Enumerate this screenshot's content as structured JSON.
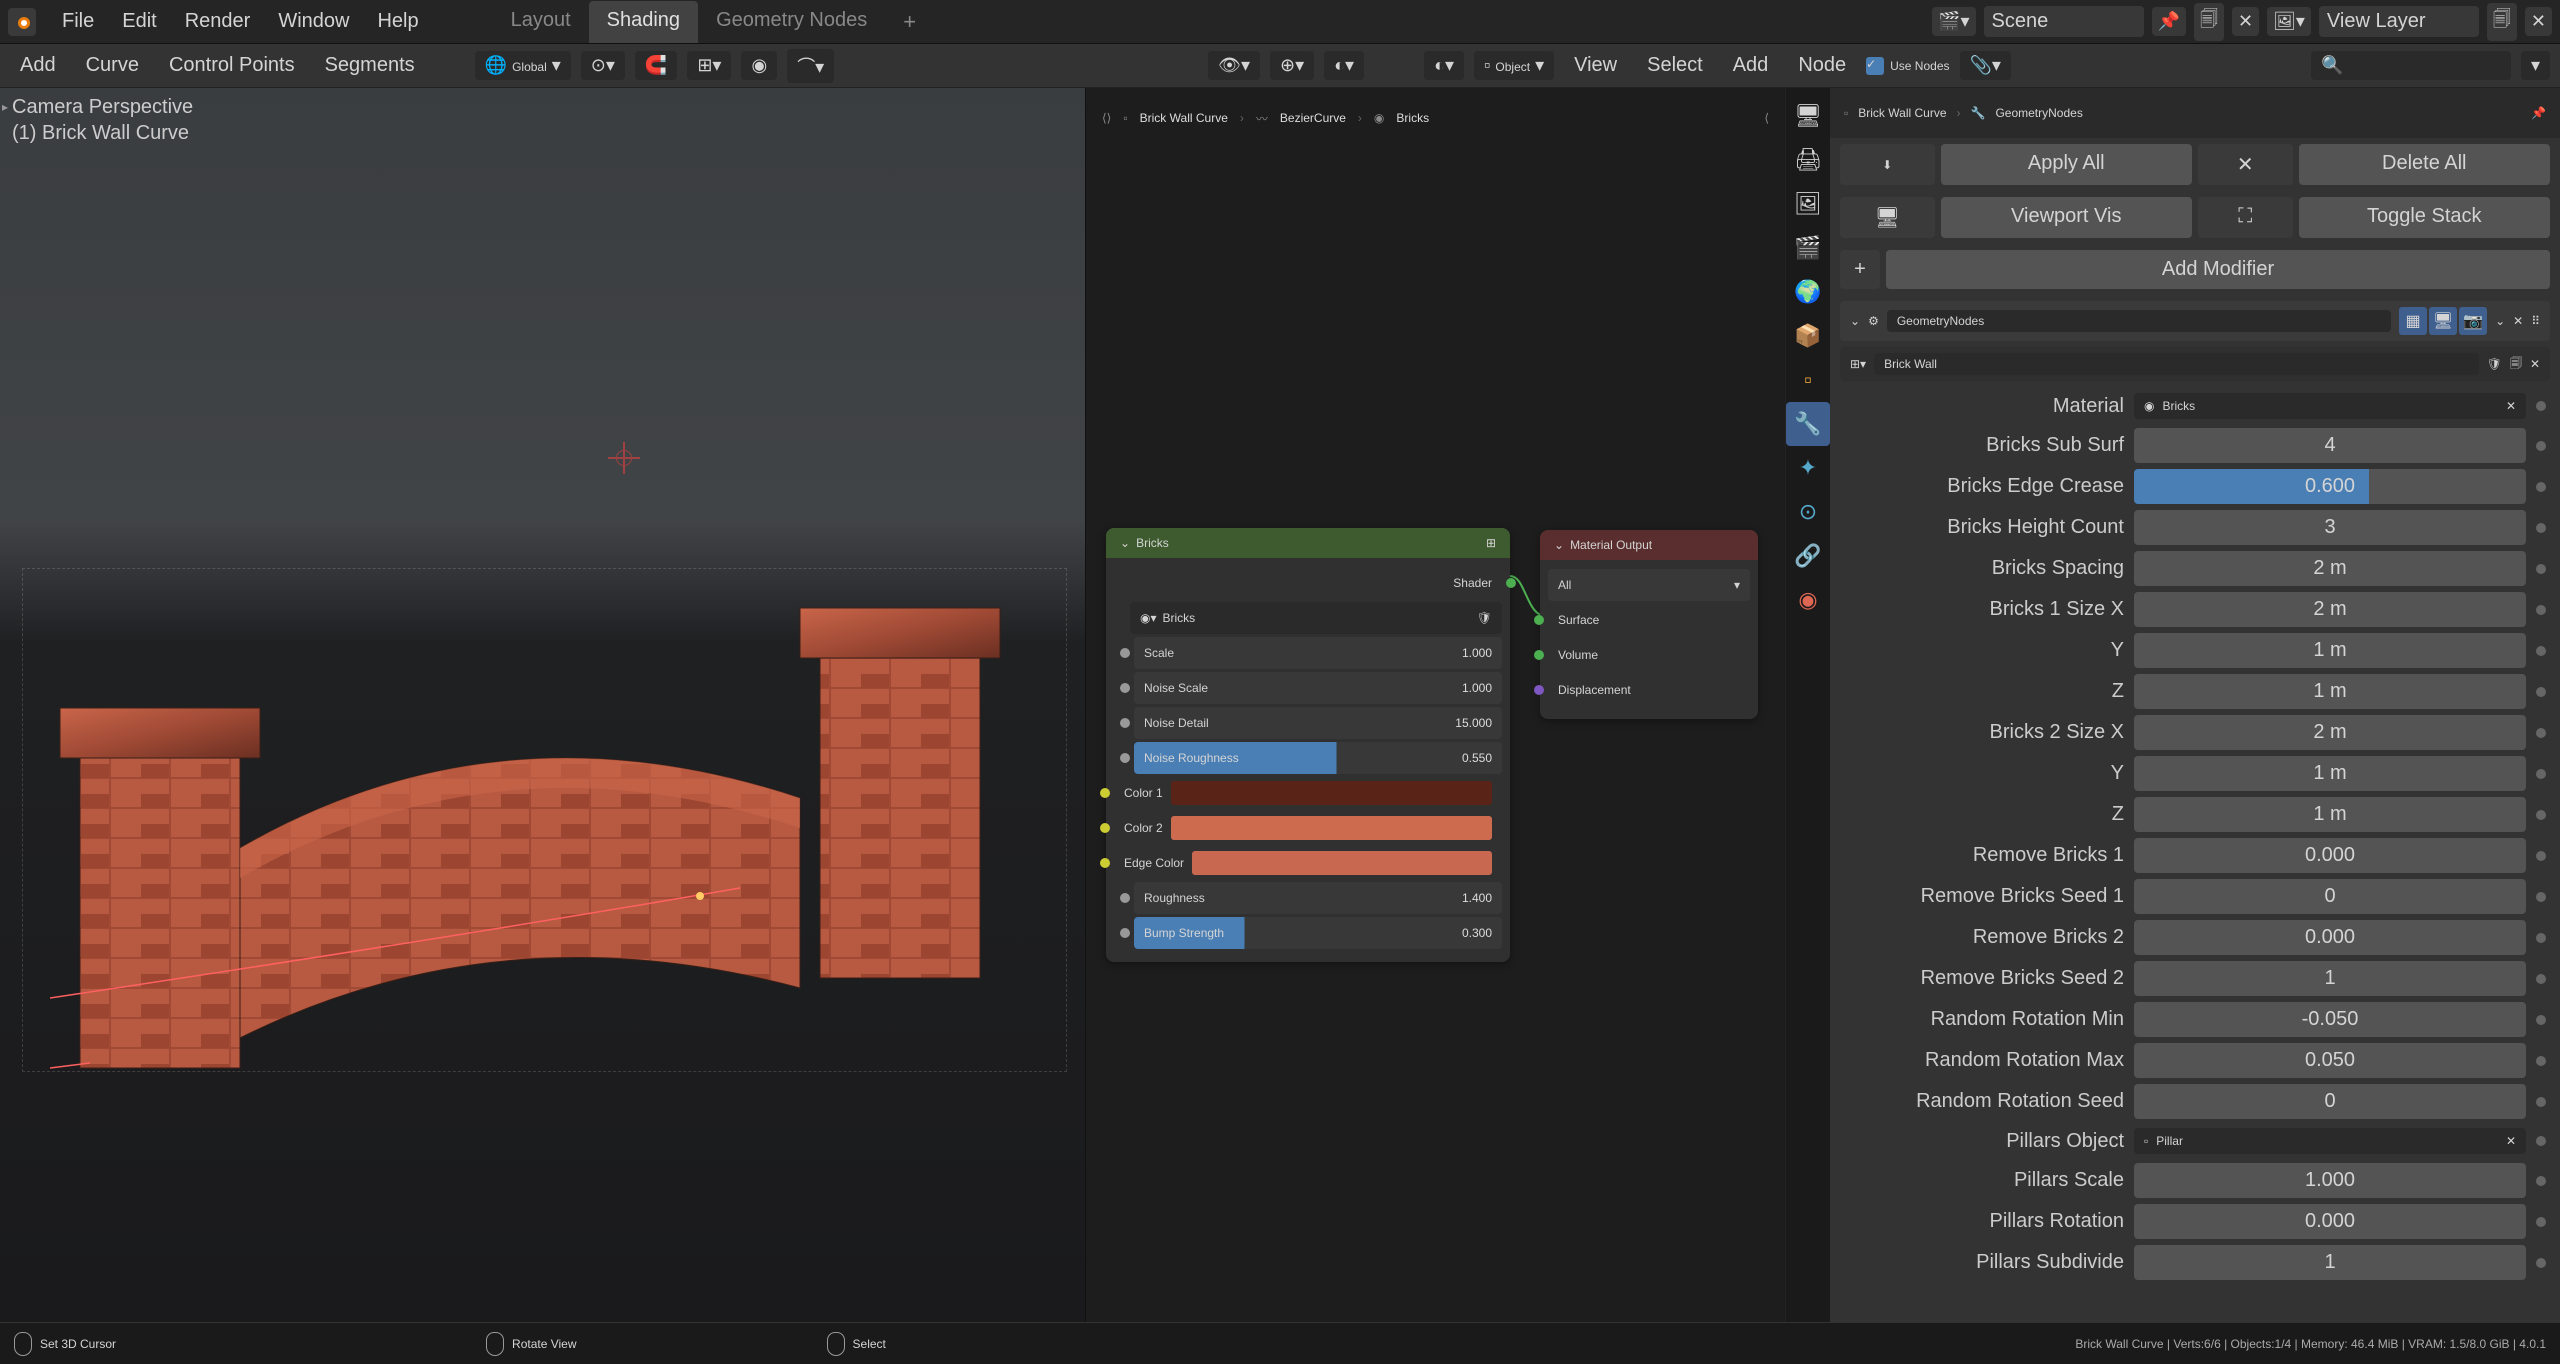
{
  "menubar": {
    "file": "File",
    "edit": "Edit",
    "render": "Render",
    "window": "Window",
    "help": "Help"
  },
  "workspaces": {
    "layout": "Layout",
    "shading": "Shading",
    "geonodes": "Geometry Nodes"
  },
  "scene": {
    "name": "Scene",
    "viewlayer": "View Layer"
  },
  "toolbar": {
    "add": "Add",
    "curve": "Curve",
    "ctrlpoints": "Control Points",
    "segments": "Segments",
    "global": "Global",
    "object": "Object",
    "view": "View",
    "select": "Select",
    "add2": "Add",
    "node": "Node",
    "usenodes": "Use Nodes"
  },
  "viewport": {
    "title": "Camera Perspective",
    "sub": "(1) Brick Wall Curve"
  },
  "breadcrumb": {
    "a": "Brick Wall Curve",
    "b": "BezierCurve",
    "c": "Bricks"
  },
  "node_bricks": {
    "title": "Bricks",
    "shader": "Shader",
    "matname": "Bricks",
    "scale_l": "Scale",
    "scale_v": "1.000",
    "nscale_l": "Noise Scale",
    "nscale_v": "1.000",
    "ndetail_l": "Noise Detail",
    "ndetail_v": "15.000",
    "nrough_l": "Noise Roughness",
    "nrough_v": "0.550",
    "c1_l": "Color 1",
    "c2_l": "Color 2",
    "edge_l": "Edge Color",
    "rough_l": "Roughness",
    "rough_v": "1.400",
    "bump_l": "Bump Strength",
    "bump_v": "0.300"
  },
  "node_output": {
    "title": "Material Output",
    "all": "All",
    "surface": "Surface",
    "volume": "Volume",
    "disp": "Displacement"
  },
  "prop_bc": {
    "a": "Brick Wall Curve",
    "b": "GeometryNodes"
  },
  "prop_btns": {
    "apply": "Apply All",
    "delete": "Delete All",
    "viewport": "Viewport Vis",
    "toggle": "Toggle Stack",
    "addmod": "Add Modifier"
  },
  "modifier": {
    "name": "GeometryNodes",
    "ng": "Brick Wall"
  },
  "props": {
    "material_l": "Material",
    "material_v": "Bricks",
    "subsurf_l": "Bricks Sub Surf",
    "subsurf_v": "4",
    "crease_l": "Bricks Edge Crease",
    "crease_v": "0.600",
    "hcount_l": "Bricks Height Count",
    "hcount_v": "3",
    "spacing_l": "Bricks Spacing",
    "spacing_v": "2 m",
    "b1x_l": "Bricks 1 Size X",
    "b1x_v": "2 m",
    "b1y_l": "Y",
    "b1y_v": "1 m",
    "b1z_l": "Z",
    "b1z_v": "1 m",
    "b2x_l": "Bricks 2 Size X",
    "b2x_v": "2 m",
    "b2y_l": "Y",
    "b2y_v": "1 m",
    "b2z_l": "Z",
    "b2z_v": "1 m",
    "rb1_l": "Remove Bricks 1",
    "rb1_v": "0.000",
    "rbs1_l": "Remove Bricks Seed 1",
    "rbs1_v": "0",
    "rb2_l": "Remove Bricks 2",
    "rb2_v": "0.000",
    "rbs2_l": "Remove Bricks Seed 2",
    "rbs2_v": "1",
    "rrmin_l": "Random Rotation Min",
    "rrmin_v": "-0.050",
    "rrmax_l": "Random Rotation Max",
    "rrmax_v": "0.050",
    "rrseed_l": "Random Rotation Seed",
    "rrseed_v": "0",
    "pobj_l": "Pillars Object",
    "pobj_v": "Pillar",
    "pscale_l": "Pillars Scale",
    "pscale_v": "1.000",
    "prot_l": "Pillars Rotation",
    "prot_v": "0.000",
    "psub_l": "Pillars Subdivide",
    "psub_v": "1"
  },
  "status": {
    "cursor": "Set 3D Cursor",
    "rotate": "Rotate View",
    "select": "Select",
    "info": "Brick Wall Curve  |  Verts:6/6  |  Objects:1/4  |  Memory: 46.4 MiB  |  VRAM: 1.5/8.0 GiB  |  4.0.1"
  }
}
